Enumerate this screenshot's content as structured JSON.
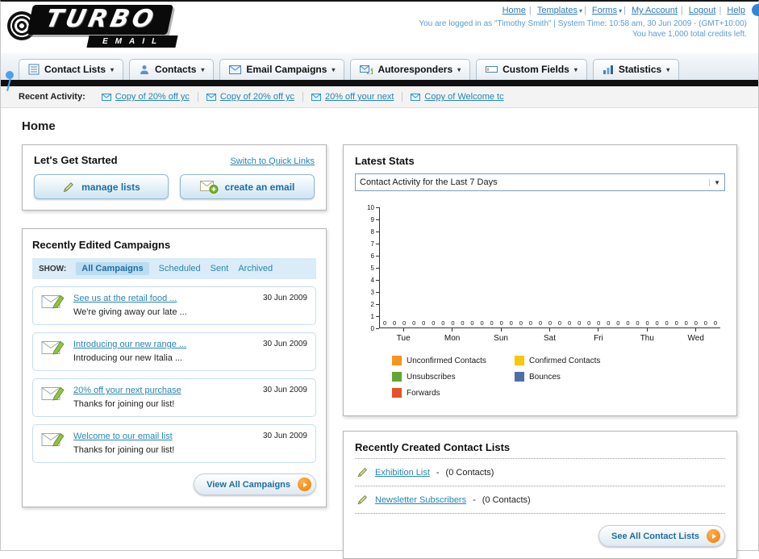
{
  "colors": {
    "link_blue": "#2585b5",
    "accent_orange": "#ef7c00",
    "nav_black": "#101010"
  },
  "header": {
    "logo_primary": "TURBO",
    "logo_secondary": "EMAIL",
    "links": [
      {
        "label": "Home"
      },
      {
        "label": "Templates"
      },
      {
        "label": "Forms"
      },
      {
        "label": "My Account"
      },
      {
        "label": "Logout"
      },
      {
        "label": "Help"
      }
    ],
    "login_info": "You are logged in as \"Timothy Smith\" | System Time: 10:58 am, 30 Jun 2009 - (GMT+10:00)",
    "credits_info": "You have 1,000 total credits left."
  },
  "main_nav": {
    "tabs": [
      {
        "label": "Contact Lists"
      },
      {
        "label": "Contacts"
      },
      {
        "label": "Email Campaigns"
      },
      {
        "label": "Autoresponders"
      },
      {
        "label": "Custom Fields"
      },
      {
        "label": "Statistics"
      }
    ]
  },
  "recent_activity": {
    "label": "Recent Activity:",
    "items": [
      "Copy of 20% off yc",
      "Copy of 20% off yc",
      "20% off your next",
      "Copy of Welcome tc"
    ]
  },
  "page_title": "Home",
  "get_started": {
    "title": "Let's Get Started",
    "switch_link": "Switch to Quick Links",
    "manage_lists_label": "manage lists",
    "create_email_label": "create an email"
  },
  "campaigns": {
    "title": "Recently Edited Campaigns",
    "show_label": "SHOW:",
    "filters": [
      "All Campaigns",
      "Scheduled",
      "Sent",
      "Archived"
    ],
    "items": [
      {
        "title": "See us at the retail food ...",
        "subtitle": "We're giving away our late ...",
        "date": "30 Jun 2009"
      },
      {
        "title": "Introducing our new range ...",
        "subtitle": "Introducing our new Italia ...",
        "date": "30 Jun 2009"
      },
      {
        "title": "20% off your next purchase",
        "subtitle": "Thanks for joining our list!",
        "date": "30 Jun 2009"
      },
      {
        "title": "Welcome to our email list",
        "subtitle": "Thanks for joining our list!",
        "date": "30 Jun 2009"
      }
    ],
    "view_all_label": "View All Campaigns"
  },
  "stats": {
    "title": "Latest Stats",
    "dropdown_value": "Contact Activity for the Last 7 Days",
    "chart_data": {
      "type": "bar",
      "title": "Contact Activity for the Last 7 Days",
      "categories": [
        "Tue",
        "Mon",
        "Sun",
        "Sat",
        "Fri",
        "Thu",
        "Wed"
      ],
      "series": [
        {
          "name": "Unconfirmed Contacts",
          "color": "#f7941d",
          "values": [
            0,
            0,
            0,
            0,
            0,
            0,
            0
          ]
        },
        {
          "name": "Confirmed Contacts",
          "color": "#fdc60b",
          "values": [
            0,
            0,
            0,
            0,
            0,
            0,
            0
          ]
        },
        {
          "name": "Unsubscribes",
          "color": "#61a633",
          "values": [
            0,
            0,
            0,
            0,
            0,
            0,
            0
          ]
        },
        {
          "name": "Bounces",
          "color": "#4f6fa8",
          "values": [
            0,
            0,
            0,
            0,
            0,
            0,
            0
          ]
        },
        {
          "name": "Forwards",
          "color": "#e4512a",
          "values": [
            0,
            0,
            0,
            0,
            0,
            0,
            0
          ]
        }
      ],
      "ylim": [
        0,
        10
      ],
      "yticks": [
        0,
        1,
        2,
        3,
        4,
        5,
        6,
        7,
        8,
        9,
        10
      ],
      "grid": false,
      "legend_position": "bottom"
    }
  },
  "contact_lists": {
    "title": "Recently Created Contact Lists",
    "items": [
      {
        "name": "Exhibition List",
        "sep": "-",
        "count": "(0 Contacts)"
      },
      {
        "name": "Newsletter Subscribers",
        "sep": "-",
        "count": "(0 Contacts)"
      }
    ],
    "see_all_label": "See All Contact Lists"
  }
}
